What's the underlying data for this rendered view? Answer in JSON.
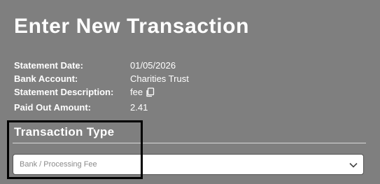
{
  "header": {
    "title": "Enter New Transaction"
  },
  "details": {
    "statement_date": {
      "label": "Statement Date:",
      "value": "01/05/2026"
    },
    "bank_account": {
      "label": "Bank Account:",
      "value": "Charities Trust"
    },
    "statement_description": {
      "label": "Statement Description:",
      "value": "fee",
      "icon": "copy-icon"
    },
    "paid_out_amount": {
      "label": "Paid Out Amount:",
      "value": "2.41"
    }
  },
  "transaction_type": {
    "title": "Transaction Type",
    "selected": "Bank / Processing Fee",
    "icon": "chevron-down-icon"
  },
  "colors": {
    "background": "#7f7f7f",
    "text": "#ffffff",
    "highlight": "#000000"
  }
}
